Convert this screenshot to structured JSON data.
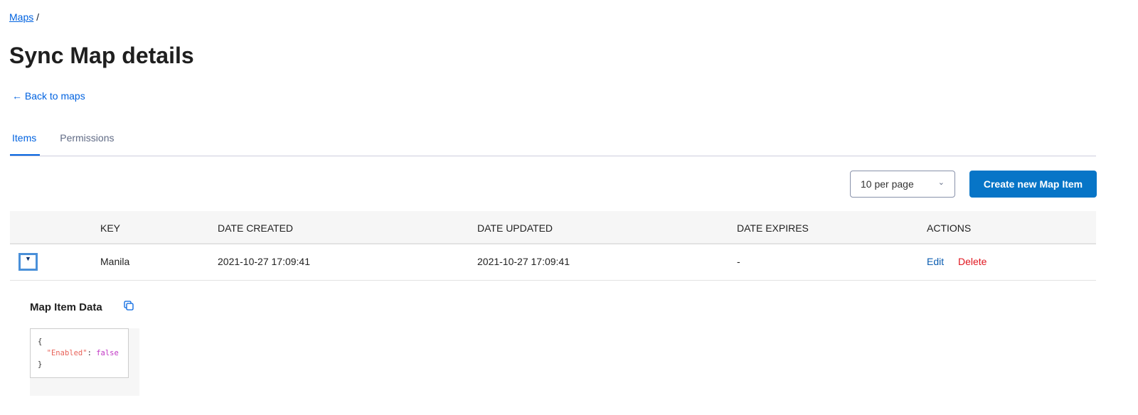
{
  "breadcrumb": {
    "link": "Maps",
    "separator": "/"
  },
  "title": "Sync Map details",
  "back_link": "← Back to maps",
  "tabs": [
    {
      "label": "Items",
      "active": true
    },
    {
      "label": "Permissions",
      "active": false
    }
  ],
  "toolbar": {
    "page_size": "10 per page",
    "create_label": "Create new Map Item"
  },
  "table": {
    "headers": [
      "KEY",
      "DATE CREATED",
      "DATE UPDATED",
      "DATE EXPIRES",
      "ACTIONS"
    ],
    "rows": [
      {
        "key": "Manila",
        "created": "2021-10-27 17:09:41",
        "updated": "2021-10-27 17:09:41",
        "expires": "-",
        "edit": "Edit",
        "delete": "Delete"
      }
    ]
  },
  "detail": {
    "title": "Map Item Data",
    "json_open": "{",
    "json_key": "\"Enabled\"",
    "json_colon": ": ",
    "json_value": "false",
    "json_close": "}"
  },
  "colors": {
    "link": "#0263e0",
    "primary": "#0775c7",
    "danger": "#e0161f"
  }
}
